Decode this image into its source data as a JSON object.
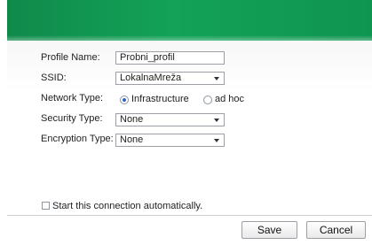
{
  "form": {
    "profile_name_label": "Profile Name:",
    "profile_name_value": "Probni_profil",
    "ssid_label": "SSID:",
    "ssid_value": "LokalnaMreža",
    "network_type_label": "Network Type:",
    "network_type_options": {
      "infrastructure": "Infrastructure",
      "adhoc": "ad hoc"
    },
    "network_type_selected": "Infrastructure",
    "security_type_label": "Security Type:",
    "security_type_value": "None",
    "encryption_type_label": "Encryption Type:",
    "encryption_type_value": "None"
  },
  "auto_start": {
    "label": "Start this connection automatically.",
    "checked": false
  },
  "buttons": {
    "save": "Save",
    "cancel": "Cancel"
  },
  "colors": {
    "header_green": "#13a257"
  }
}
